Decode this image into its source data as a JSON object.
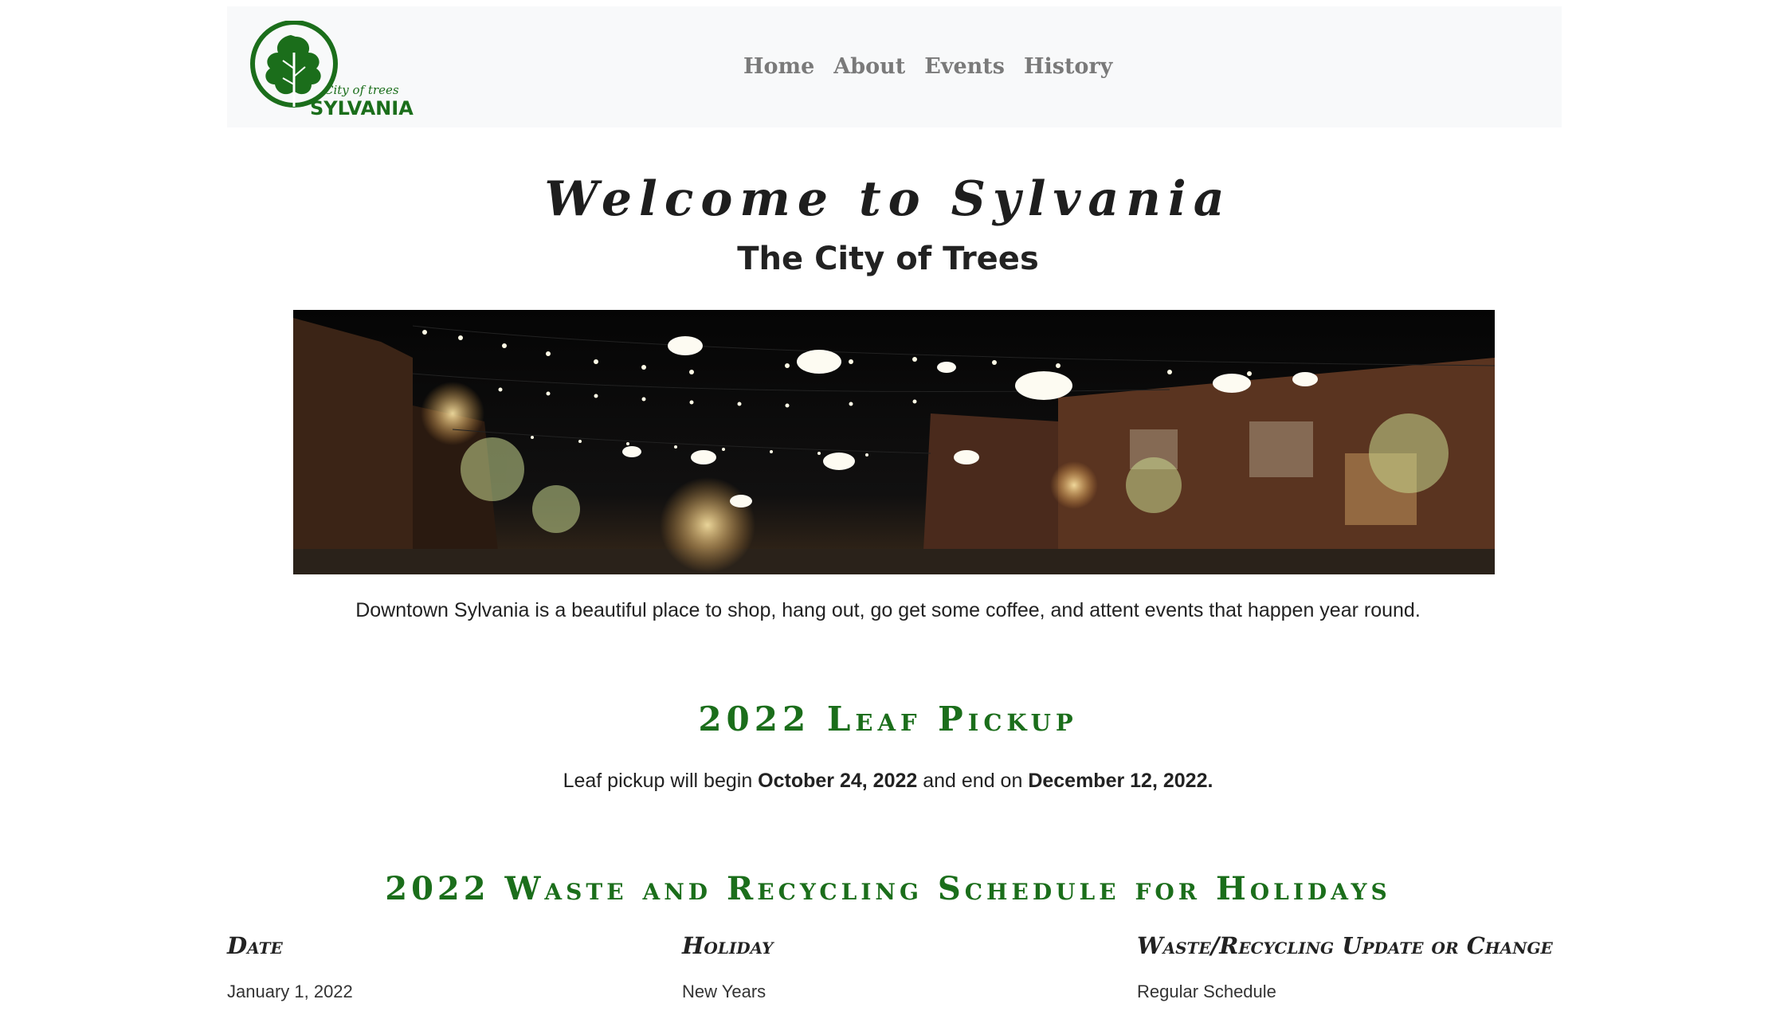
{
  "nav": {
    "logo": {
      "tagline": "City of trees",
      "name": "SYLVANIA"
    },
    "links": [
      "Home",
      "About",
      "Events",
      "History"
    ]
  },
  "hero": {
    "title": "Welcome to Sylvania",
    "subtitle": "The City of Trees",
    "intro": "Downtown Sylvania is a beautiful place to shop, hang out, go get some coffee, and attent events that happen year round."
  },
  "leaf_pickup": {
    "heading": "2022 Leaf Pickup",
    "text_before": "Leaf pickup will begin ",
    "start_date": "October 24, 2022",
    "text_middle": " and end on ",
    "end_date": "December 12, 2022."
  },
  "waste_schedule": {
    "heading": "2022 Waste and Recycling Schedule for Holidays",
    "columns": [
      "Date",
      "Holiday",
      "Waste/Recycling Update or Change"
    ],
    "rows": [
      [
        "January 1, 2022",
        "New Years",
        "Regular Schedule"
      ]
    ]
  },
  "colors": {
    "brand_green": "#1b6e1b",
    "nav_bg": "#f8f9fa",
    "nav_link": "#7a7a7a"
  }
}
